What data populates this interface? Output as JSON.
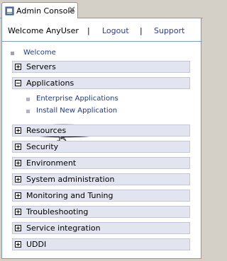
{
  "tab": {
    "title": "Admin Console",
    "icon": "admin-console-icon",
    "close_icon": "close-icon"
  },
  "header": {
    "welcome": "Welcome AnyUser",
    "separator": "|",
    "logout": "Logout",
    "support": "Support"
  },
  "nav": {
    "welcome": "Welcome",
    "categories": [
      {
        "label": "Servers",
        "expanded": false
      },
      {
        "label": "Applications",
        "expanded": true,
        "children": [
          "Enterprise Applications",
          "Install New Application"
        ]
      },
      {
        "label": "Resources",
        "expanded": false
      },
      {
        "label": "Security",
        "expanded": false
      },
      {
        "label": "Environment",
        "expanded": false
      },
      {
        "label": "System administration",
        "expanded": false
      },
      {
        "label": "Monitoring and Tuning",
        "expanded": false
      },
      {
        "label": "Troubleshooting",
        "expanded": false
      },
      {
        "label": "Service integration",
        "expanded": false
      },
      {
        "label": "UDDI",
        "expanded": false
      }
    ]
  },
  "colors": {
    "link": "#1e3a8a",
    "category_bg": "#e2e4f0",
    "frame": "#d4d0c8",
    "border": "#7f9db9"
  }
}
